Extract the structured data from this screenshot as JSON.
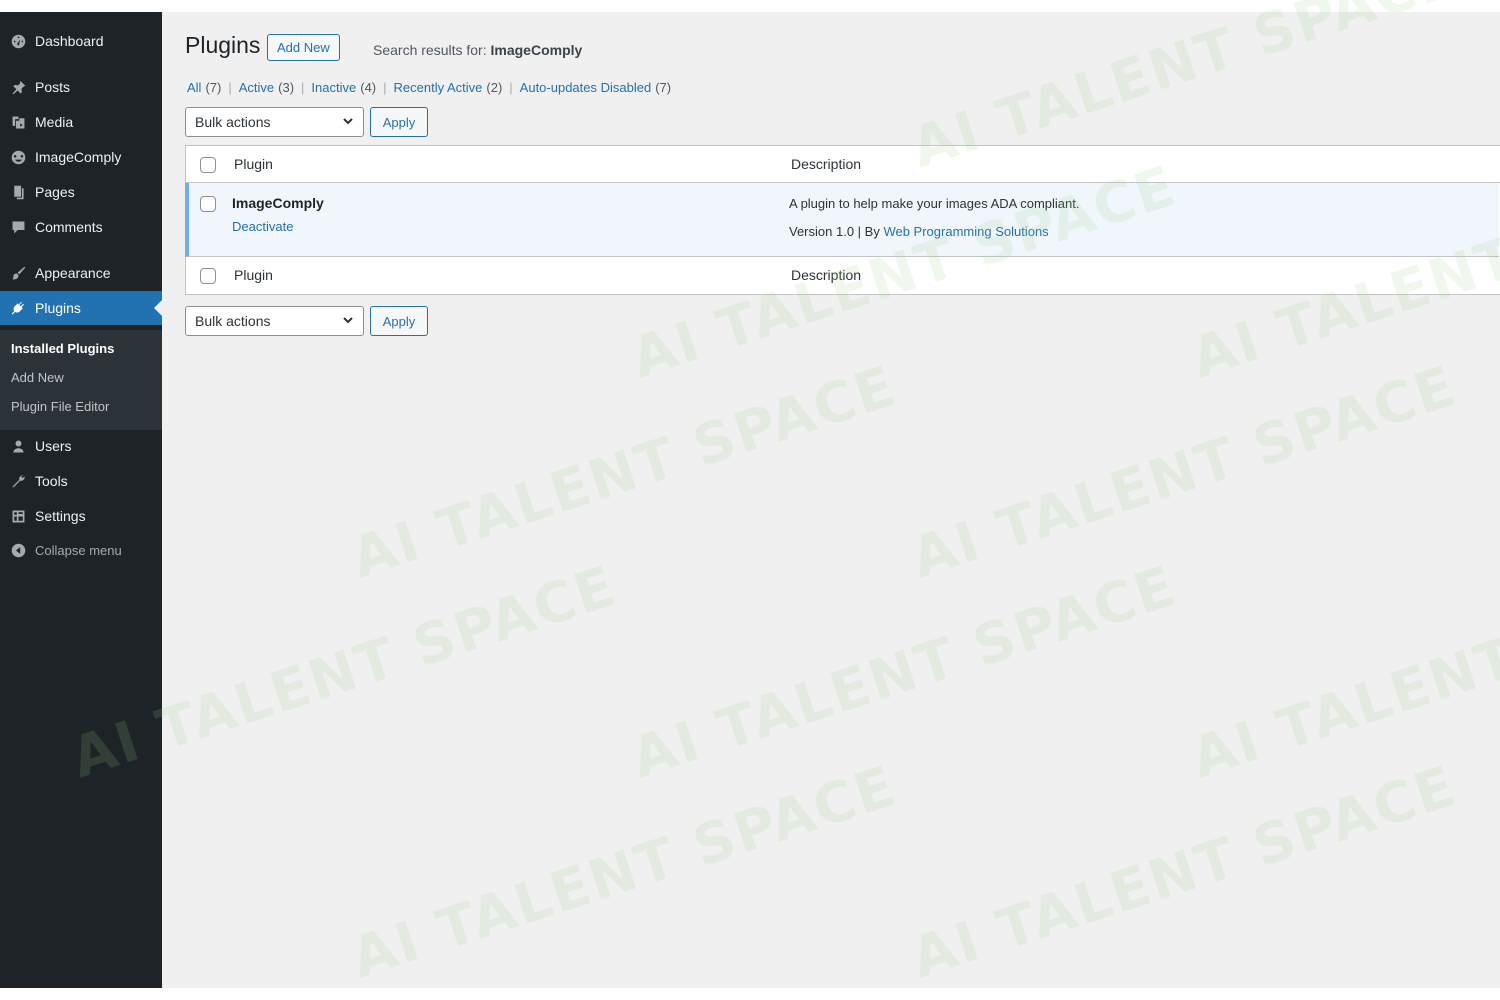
{
  "sidebar": {
    "items": [
      {
        "label": "Dashboard",
        "icon": "dashboard-icon"
      },
      {
        "label": "Posts",
        "icon": "pushpin-icon"
      },
      {
        "label": "Media",
        "icon": "media-icon"
      },
      {
        "label": "ImageComply",
        "icon": "imagecomply-icon"
      },
      {
        "label": "Pages",
        "icon": "pages-icon"
      },
      {
        "label": "Comments",
        "icon": "comment-icon"
      },
      {
        "label": "Appearance",
        "icon": "paintbrush-icon"
      },
      {
        "label": "Plugins",
        "icon": "plugin-icon"
      },
      {
        "label": "Users",
        "icon": "users-icon"
      },
      {
        "label": "Tools",
        "icon": "wrench-icon"
      },
      {
        "label": "Settings",
        "icon": "settings-icon"
      },
      {
        "label": "Collapse menu",
        "icon": "collapse-icon"
      }
    ],
    "submenu": [
      {
        "label": "Installed Plugins"
      },
      {
        "label": "Add New"
      },
      {
        "label": "Plugin File Editor"
      }
    ]
  },
  "header": {
    "title": "Plugins",
    "add_new_label": "Add New",
    "search_prefix": "Search results for:",
    "search_term": "ImageComply"
  },
  "filters": [
    {
      "label": "All",
      "count": "(7)"
    },
    {
      "label": "Active",
      "count": "(3)"
    },
    {
      "label": "Inactive",
      "count": "(4)"
    },
    {
      "label": "Recently Active",
      "count": "(2)"
    },
    {
      "label": "Auto-updates Disabled",
      "count": "(7)"
    }
  ],
  "bulk_actions": {
    "selected": "Bulk actions",
    "apply_label": "Apply"
  },
  "table": {
    "columns": {
      "plugin": "Plugin",
      "description": "Description"
    },
    "rows": [
      {
        "name": "ImageComply",
        "action": "Deactivate",
        "description": "A plugin to help make your images ADA compliant.",
        "version": "Version 1.0",
        "by": "By",
        "author": "Web Programming Solutions"
      }
    ]
  },
  "colors": {
    "sidebar_bg": "#1d2327",
    "accent": "#2271b1",
    "active_row_bg": "#f0f6fc",
    "active_row_border": "#72aee6"
  },
  "watermark": "AI TALENT SPACE"
}
